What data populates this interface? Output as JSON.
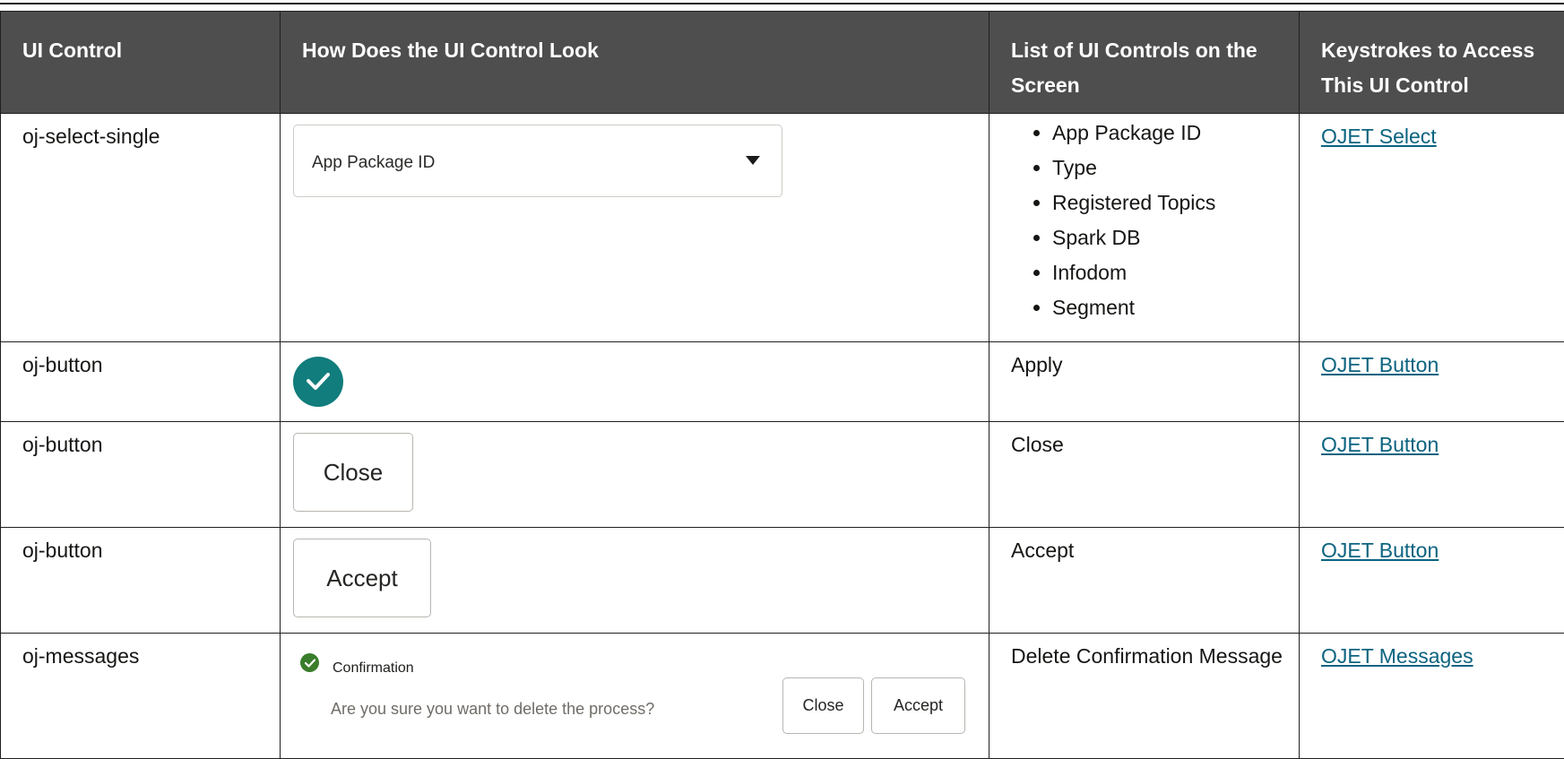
{
  "header": {
    "col1": "UI Control",
    "col2": "How Does the UI Control Look",
    "col3": "List of UI Controls on the Screen",
    "col4": "Keystrokes to Access This UI Control"
  },
  "rows": [
    {
      "control": "oj-select-single",
      "look": {
        "select_value": "App Package ID",
        "icon": "caret-down-icon"
      },
      "controls_list": [
        "App Package ID",
        "Type",
        "Registered Topics",
        "Spark DB",
        "Infodom",
        "Segment"
      ],
      "keystroke_link": "OJET Select"
    },
    {
      "control": "oj-button",
      "look": {
        "icon": "check-circle-icon",
        "color": "#117d7c"
      },
      "controls_text": "Apply",
      "keystroke_link": "OJET Button"
    },
    {
      "control": "oj-button",
      "look": {
        "button_label": "Close"
      },
      "controls_text": "Close",
      "keystroke_link": "OJET Button"
    },
    {
      "control": "oj-button",
      "look": {
        "button_label": "Accept"
      },
      "controls_text": "Accept",
      "keystroke_link": "OJET Button"
    },
    {
      "control": "oj-messages",
      "look": {
        "icon": "success-check-icon",
        "title": "Confirmation",
        "body": "Are you sure you want to delete the process?",
        "close_label": "Close",
        "accept_label": "Accept"
      },
      "controls_text": "Delete Confirmation Message",
      "keystroke_link": "OJET Messages"
    }
  ],
  "colors": {
    "header_bg": "#4f4e4e",
    "link": "#0b6380",
    "teal": "#117d7c",
    "success": "#3a7d2b"
  }
}
